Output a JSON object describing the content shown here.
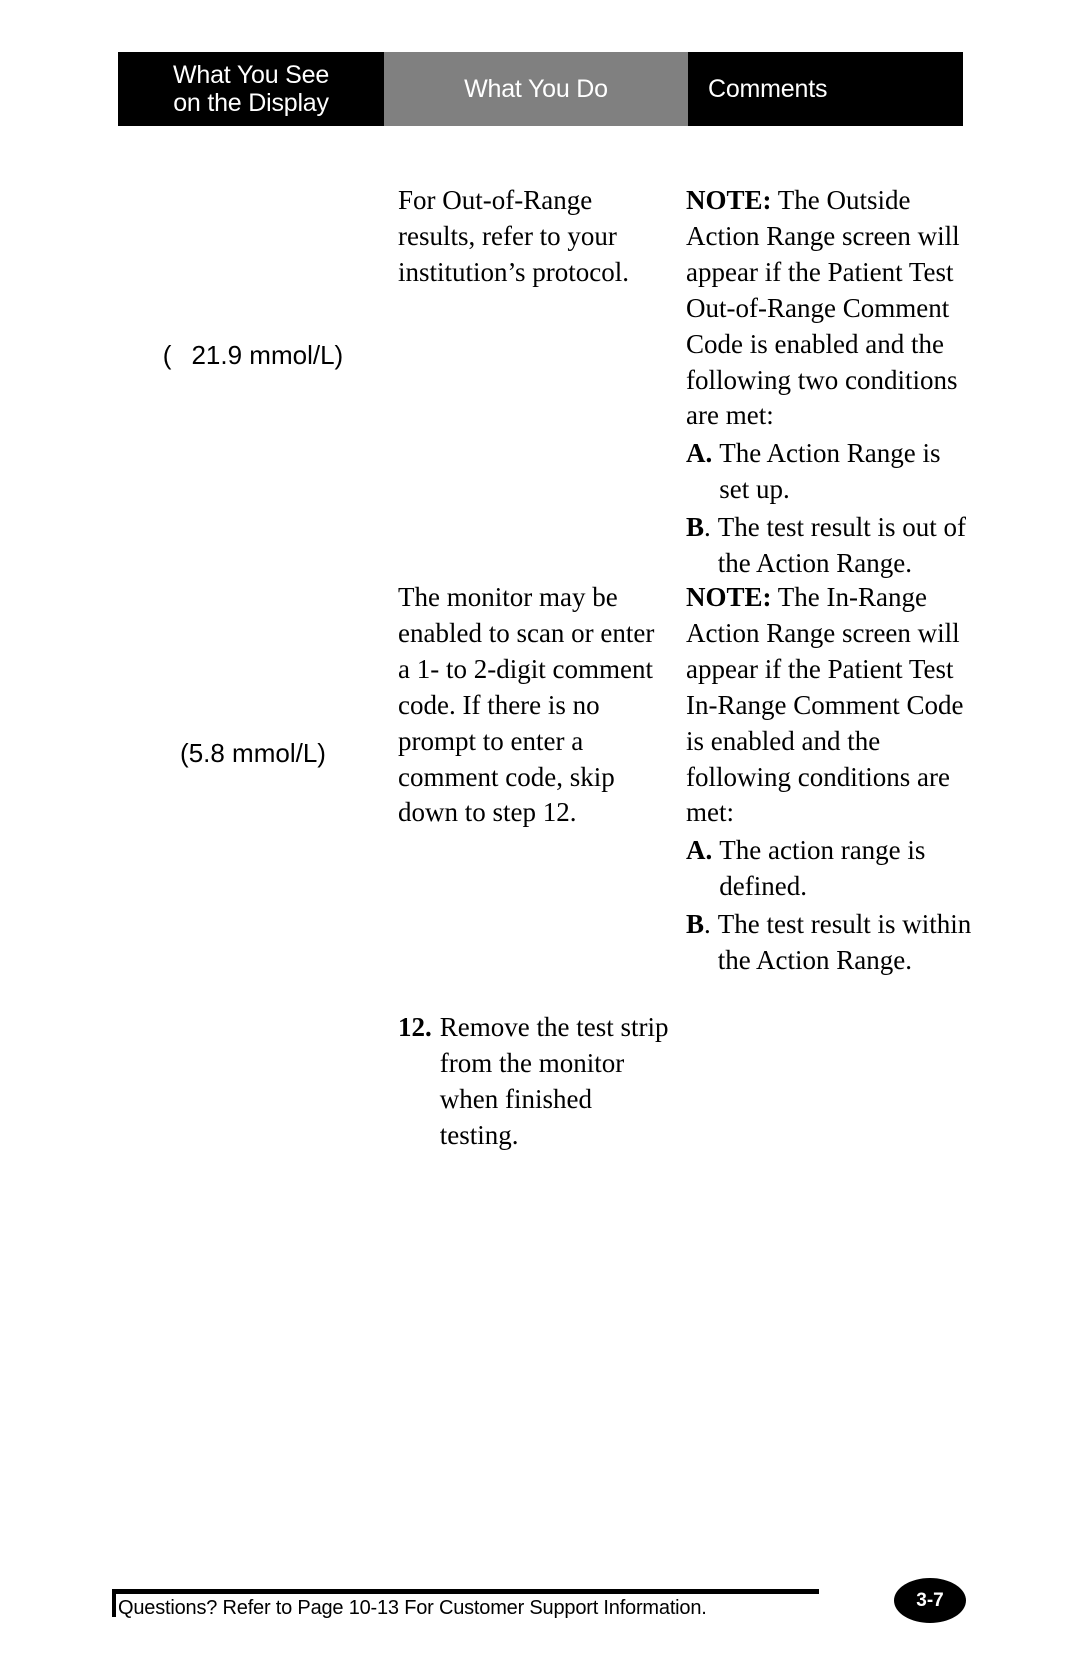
{
  "table": {
    "headers": {
      "display": "What You See\non the Display",
      "display_line1": "What You See",
      "display_line2": "on the Display",
      "do": "What You Do",
      "comments": "Comments"
    },
    "rows": [
      {
        "display_value_prefix": "(",
        "display_value_main": "21.9 mmol/L)",
        "display_value_full": "(  21.9 mmol/L)",
        "what_you_do": "For Out-of-Range results, refer to your institution’s protocol.",
        "comments": {
          "note_label": "NOTE:",
          "note_text": " The Outside Action Range screen will appear if the Patient Test Out-of-Range Comment Code is enabled and the following two conditions are met:",
          "conditions": [
            {
              "marker": "A.",
              "text": "The Action Range is set up."
            },
            {
              "marker": "B",
              "marker_punct": ".",
              "text": "The test result is out of the Action Range."
            }
          ]
        }
      },
      {
        "display_value_full": "(5.8 mmol/L)",
        "what_you_do": "The monitor may be enabled to scan or enter a 1- to 2-digit comment code. If there is no prompt to enter a comment code, skip down to step 12.",
        "comments": {
          "note_label": "NOTE:",
          "note_text": " The In-Range Action Range screen will appear if the Patient Test In-Range Comment Code is enabled and the following conditions are met:",
          "conditions": [
            {
              "marker": "A.",
              "text": "The action range is defined."
            },
            {
              "marker": "B",
              "marker_punct": ".",
              "text": "The test result is within the Action Range."
            }
          ]
        }
      }
    ],
    "steps": [
      {
        "number": "12.",
        "text": "Remove the test strip from the monitor when finished testing."
      }
    ]
  },
  "footer": {
    "support_text": "Questions? Refer to Page 10-13  For Customer Support Information.",
    "page_number": "3-7"
  },
  "colors": {
    "header_dark": "#000000",
    "header_gray": "#808080",
    "text": "#000000",
    "background": "#ffffff"
  }
}
